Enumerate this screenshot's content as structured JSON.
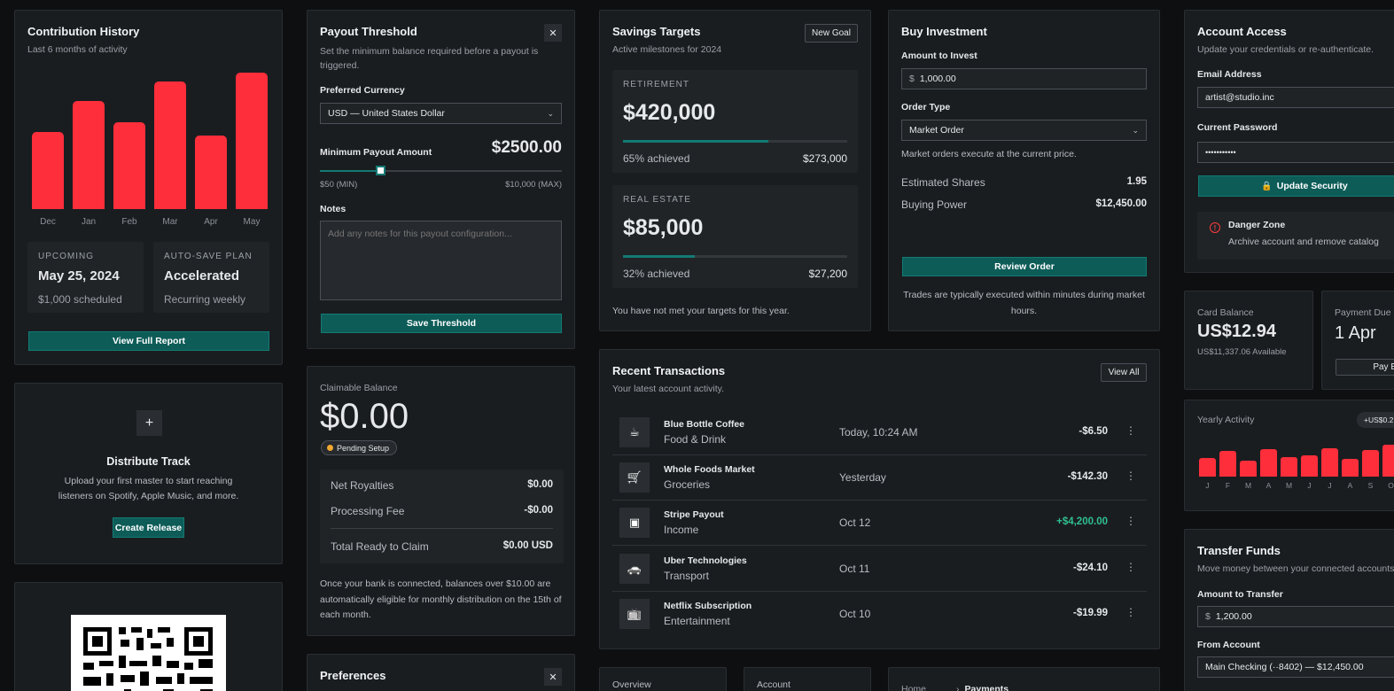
{
  "contribution": {
    "title": "Contribution History",
    "subtitle": "Last 6 months of activity",
    "upcoming_label": "UPCOMING",
    "upcoming_value": "May 25, 2024",
    "upcoming_sub": "$1,000 scheduled",
    "autosave_label": "AUTO-SAVE PLAN",
    "autosave_value": "Accelerated",
    "autosave_sub": "Recurring weekly",
    "button": "View Full Report"
  },
  "chart_data": [
    {
      "type": "bar",
      "categories": [
        "Dec",
        "Jan",
        "Feb",
        "Mar",
        "Apr",
        "May"
      ],
      "values": [
        56,
        78,
        63,
        92,
        53,
        99
      ],
      "ylim": [
        0,
        100
      ],
      "grid": false,
      "color": "#ff2e3b"
    },
    {
      "type": "bar",
      "categories": [
        "J",
        "F",
        "M",
        "A",
        "M",
        "J",
        "J",
        "A",
        "S",
        "O"
      ],
      "values": [
        45,
        62,
        40,
        68,
        48,
        52,
        70,
        44,
        65,
        78
      ],
      "ylim": [
        0,
        100
      ],
      "grid": false,
      "color": "#ff2e3b"
    }
  ],
  "distribute": {
    "plus": "+",
    "title": "Distribute Track",
    "text": "Upload your first master to start reaching listeners on Spotify, Apple Music, and more.",
    "button": "Create Release"
  },
  "payout": {
    "title": "Payout Threshold",
    "close": "✕",
    "subtitle": "Set the minimum balance required before a payout is triggered.",
    "currency_label": "Preferred Currency",
    "currency_value": "USD — United States Dollar",
    "min_label": "Minimum Payout Amount",
    "min_value": "$2500.00",
    "slider_min": "$50 (MIN)",
    "slider_max": "$10,000 (MAX)",
    "slider_fraction": 0.25,
    "notes_label": "Notes",
    "notes_placeholder": "Add any notes for this payout configuration...",
    "button": "Save Threshold"
  },
  "claim": {
    "label": "Claimable Balance",
    "value": "$0.00",
    "badge": "Pending Setup",
    "rows": [
      {
        "k": "Net Royalties",
        "v": "$0.00"
      },
      {
        "k": "Processing Fee",
        "v": "-$0.00"
      }
    ],
    "total_k": "Total Ready to Claim",
    "total_v": "$0.00 USD",
    "note": "Once your bank is connected, balances over $10.00 are automatically eligible for monthly distribution on the 15th of each month."
  },
  "preferences": {
    "title": "Preferences",
    "close": "✕"
  },
  "savings": {
    "title": "Savings Targets",
    "subtitle": "Active milestones for 2024",
    "button": "New Goal",
    "goals": [
      {
        "label": "RETIREMENT",
        "amount": "$420,000",
        "progress": 0.65,
        "achieved": "65% achieved",
        "current": "$273,000"
      },
      {
        "label": "REAL ESTATE",
        "amount": "$85,000",
        "progress": 0.32,
        "achieved": "32% achieved",
        "current": "$27,200"
      }
    ],
    "footer": "You have not met your targets for this year."
  },
  "invest": {
    "title": "Buy Investment",
    "amount_label": "Amount to Invest",
    "currency": "$",
    "amount_value": "1,000.00",
    "order_label": "Order Type",
    "order_value": "Market Order",
    "hint": "Market orders execute at the current price.",
    "shares_k": "Estimated Shares",
    "shares_v": "1.95",
    "power_k": "Buying Power",
    "power_v": "$12,450.00",
    "button": "Review Order",
    "footer": "Trades are typically executed within minutes during market hours."
  },
  "transactions": {
    "title": "Recent Transactions",
    "subtitle": "Your latest account activity.",
    "button": "View All",
    "items": [
      {
        "name": "Blue Bottle Coffee",
        "cat": "Food & Drink",
        "date": "Today, 10:24 AM",
        "amount": "-$6.50",
        "icon": "coffee-icon",
        "glyph": "☕"
      },
      {
        "name": "Whole Foods Market",
        "cat": "Groceries",
        "date": "Yesterday",
        "amount": "-$142.30",
        "icon": "cart-icon",
        "glyph": "🛒"
      },
      {
        "name": "Stripe Payout",
        "cat": "Income",
        "date": "Oct 12",
        "amount": "+$4,200.00",
        "icon": "wallet-icon",
        "glyph": "▣",
        "positive": true
      },
      {
        "name": "Uber Technologies",
        "cat": "Transport",
        "date": "Oct 11",
        "amount": "-$24.10",
        "icon": "car-icon",
        "glyph": "🚗"
      },
      {
        "name": "Netflix Subscription",
        "cat": "Entertainment",
        "date": "Oct 10",
        "amount": "-$19.99",
        "icon": "tv-icon",
        "glyph": "📺"
      }
    ],
    "more": "⋮",
    "positive_color": "#2fbf8f"
  },
  "bottom_tabs": {
    "overview": "Overview",
    "account": "Account",
    "home": "Home",
    "sep": "›",
    "payments": "Payments"
  },
  "access": {
    "title": "Account Access",
    "subtitle": "Update your credentials or re-authenticate.",
    "email_label": "Email Address",
    "email_value": "artist@studio.inc",
    "pw_label": "Current Password",
    "pw_value": "•••••••••••",
    "button": "Update Security",
    "danger_title": "Danger Zone",
    "danger_text": "Archive account and remove catalog"
  },
  "card": {
    "label": "Card Balance",
    "value": "US$12.94",
    "sub": "US$11,337.06 Available",
    "due_label": "Payment Due",
    "due_value": "1 Apr",
    "pay_btn": "Pay E"
  },
  "yearly": {
    "title": "Yearly Activity",
    "badge": "+US$0.2"
  },
  "transfer": {
    "title": "Transfer Funds",
    "subtitle": "Move money between your connected accounts.",
    "amount_label": "Amount to Transfer",
    "currency": "$",
    "amount_value": "1,200.00",
    "from_label": "From Account",
    "from_value": "Main Checking (··8402) — $12,450.00"
  }
}
